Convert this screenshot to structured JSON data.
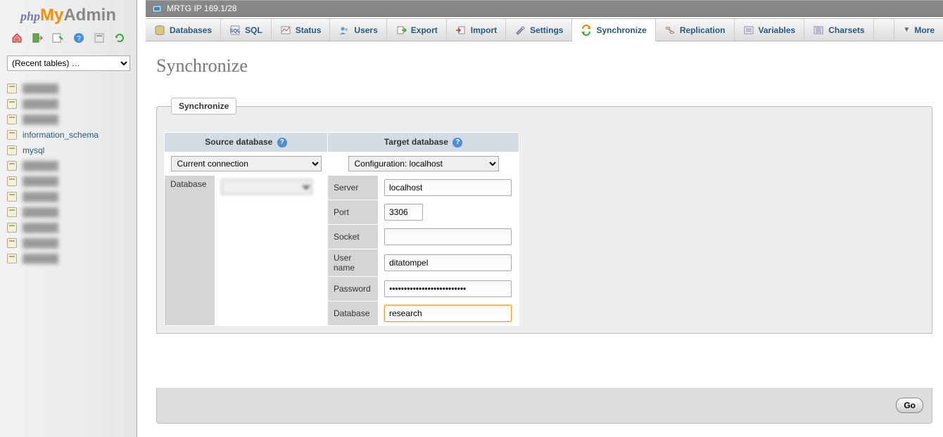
{
  "logo": {
    "php": "php",
    "my": "My",
    "admin": "Admin"
  },
  "server_info": "MRTG IP 169.1/28",
  "recent_tables_label": "(Recent tables) …",
  "sidebar": {
    "databases": [
      {
        "label": "",
        "blurred": true
      },
      {
        "label": "",
        "blurred": true
      },
      {
        "label": "",
        "blurred": true
      },
      {
        "label": "information_schema",
        "blurred": false
      },
      {
        "label": "mysql",
        "blurred": false
      },
      {
        "label": "",
        "blurred": true
      },
      {
        "label": "",
        "blurred": true
      },
      {
        "label": "",
        "blurred": true
      },
      {
        "label": "",
        "blurred": true
      },
      {
        "label": "",
        "blurred": true
      },
      {
        "label": "",
        "blurred": true
      },
      {
        "label": "",
        "blurred": true
      }
    ]
  },
  "tabs": [
    {
      "key": "databases",
      "label": "Databases"
    },
    {
      "key": "sql",
      "label": "SQL"
    },
    {
      "key": "status",
      "label": "Status"
    },
    {
      "key": "users",
      "label": "Users"
    },
    {
      "key": "export",
      "label": "Export"
    },
    {
      "key": "import",
      "label": "Import"
    },
    {
      "key": "settings",
      "label": "Settings"
    },
    {
      "key": "synchronize",
      "label": "Synchronize",
      "active": true
    },
    {
      "key": "replication",
      "label": "Replication"
    },
    {
      "key": "variables",
      "label": "Variables"
    },
    {
      "key": "charsets",
      "label": "Charsets"
    }
  ],
  "more_label": "More",
  "page_title": "Synchronize",
  "legend": "Synchronize",
  "headers": {
    "source": "Source database",
    "target": "Target database"
  },
  "source": {
    "connection_select": "Current connection",
    "database_label": "Database",
    "database_value": ""
  },
  "target": {
    "connection_select": "Configuration: localhost",
    "rows": {
      "server": {
        "label": "Server",
        "value": "localhost"
      },
      "port": {
        "label": "Port",
        "value": "3306"
      },
      "socket": {
        "label": "Socket",
        "value": ""
      },
      "username": {
        "label": "User name",
        "value": "ditatompel"
      },
      "password": {
        "label": "Password",
        "value": "••••••••••••••••••••••••••"
      },
      "database": {
        "label": "Database",
        "value": "research"
      }
    }
  },
  "go_label": "Go"
}
